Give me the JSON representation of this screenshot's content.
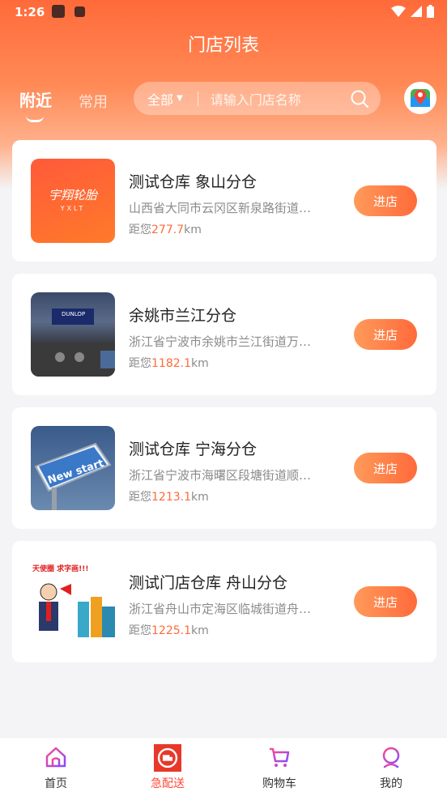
{
  "status_bar": {
    "time": "1:26"
  },
  "header": {
    "title": "门店列表"
  },
  "tabs": {
    "nearby": "附近",
    "common": "常用"
  },
  "search": {
    "filter": "全部",
    "placeholder": "请输入门店名称"
  },
  "stores": [
    {
      "name": "测试仓库 象山分仓",
      "address": "山西省大同市云冈区新泉路街道…",
      "distance_prefix": "距您",
      "distance": "277.7",
      "unit": "km",
      "button": "进店",
      "logo_text": "宇翔轮胎",
      "logo_sub": "YXLT"
    },
    {
      "name": "余姚市兰江分仓",
      "address": "浙江省宁波市余姚市兰江街道万…",
      "distance_prefix": "距您",
      "distance": "1182.1",
      "unit": "km",
      "button": "进店",
      "logo_text": "DUNLOP"
    },
    {
      "name": "测试仓库 宁海分仓",
      "address": "浙江省宁波市海曙区段塘街道顺…",
      "distance_prefix": "距您",
      "distance": "1213.1",
      "unit": "km",
      "button": "进店",
      "logo_text": "New start"
    },
    {
      "name": "测试门店仓库 舟山分仓",
      "address": "浙江省舟山市定海区临城街道舟…",
      "distance_prefix": "距您",
      "distance": "1225.1",
      "unit": "km",
      "button": "进店",
      "logo_text": "天使圈 求字画!!!"
    }
  ],
  "tabbar": {
    "home": "首页",
    "express": "急配送",
    "cart": "购物车",
    "mine": "我的"
  },
  "colors": {
    "accent": "#ff6a3a",
    "accent_light": "#ff9a5a",
    "active_tab": "#ff4a3a"
  }
}
